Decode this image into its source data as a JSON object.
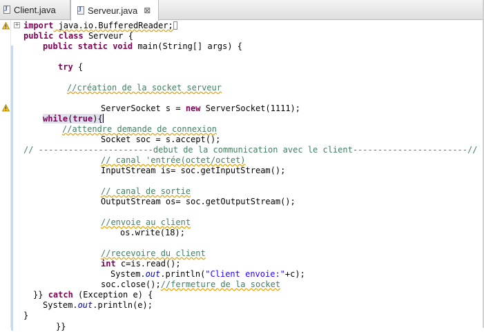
{
  "tabs": [
    {
      "label": "Client.java",
      "active": false
    },
    {
      "label": "Serveur.java",
      "active": true,
      "close": "⊠"
    }
  ],
  "icons": {
    "warning": "warning-icon",
    "fold": "fold-collapse-icon",
    "java_file": "java-file-icon"
  },
  "colors": {
    "keyword": "#7f0055",
    "comment": "#3f7f5f",
    "string": "#2a00ff",
    "field": "#0000c0",
    "squiggle": "#e5a100",
    "highlight": "#e0e0ee"
  },
  "code": {
    "l1": {
      "kw": "import",
      "t": " java.io.BufferedReader;"
    },
    "l2": {
      "kw1": "public",
      "kw2": "class",
      "t": " Serveur {"
    },
    "l3": {
      "kw1": "public",
      "kw2": "static",
      "kw3": "void",
      "t": " main(String[] args) {"
    },
    "l4": {
      "kw": "try",
      "t": " {"
    },
    "l5": {
      "c": "//création de la socket serveur"
    },
    "l6": {
      "t1": "ServerSocket s = ",
      "kw": "new",
      "t2": " ServerSocket(1111);"
    },
    "l7": {
      "kw1": "while",
      "p1": "(",
      "kw2": "true",
      "p2": "){"
    },
    "l8": {
      "c": "//attendre demande de connexion"
    },
    "l9": {
      "t": "Socket soc = s.accept();"
    },
    "l10": {
      "c": "// -----------------------debut de la communication avec le client-----------------------//"
    },
    "l11": {
      "c": "// canal 'entrée(octet/octet)"
    },
    "l12": {
      "t": "InputStream is= soc.getInputStream();"
    },
    "l13": {
      "c": "// canal de sortie"
    },
    "l14": {
      "t": "OutputStream os= soc.getOutputStream();"
    },
    "l15": {
      "c": "//envoie au client"
    },
    "l16": {
      "t": "os.write(18);"
    },
    "l17": {
      "c": "//recevoire du client"
    },
    "l18": {
      "kw": "int",
      "t": " c=is.read();"
    },
    "l19": {
      "t1": "System.",
      "f": "out",
      "t2": ".println(",
      "s": "\"Client envoie:\"",
      "t3": "+c);"
    },
    "l20": {
      "t": "soc.close();",
      "c": "//fermeture de la socket"
    },
    "l21": {
      "t1": "}} ",
      "kw": "catch",
      "t2": " (Exception e) {"
    },
    "l22": {
      "t1": "System.",
      "f": "out",
      "t2": ".println(e);"
    },
    "l23": {
      "t": "}"
    },
    "l24": {
      "t": "}}"
    }
  }
}
